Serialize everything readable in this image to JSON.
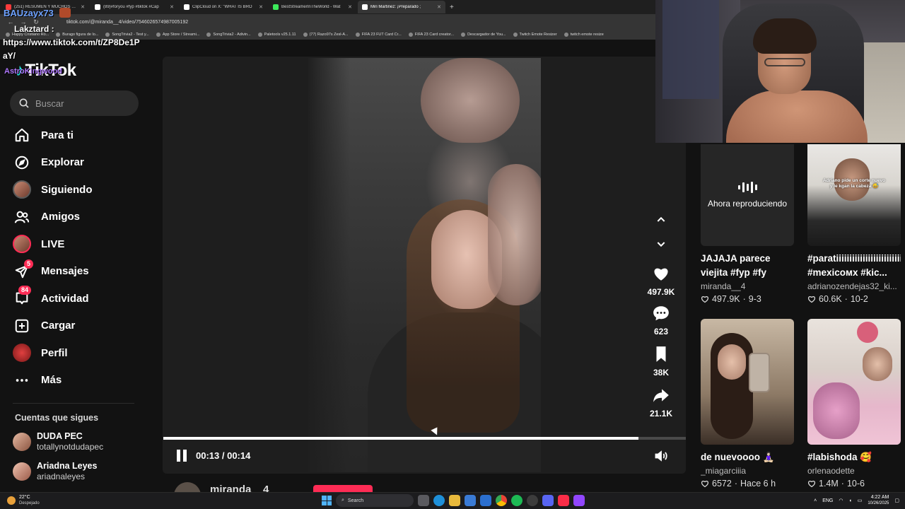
{
  "browser": {
    "tabs": [
      {
        "label": "(251) RESUMEN Y MUCHOS GO",
        "color": "#ff3b3b",
        "active": false
      },
      {
        "label": "(89)#foryou #fyp #tiktok #Cap",
        "color": "#ffffff",
        "active": false
      },
      {
        "label": "ClipCloud on X: \"WHAT IS BRO",
        "color": "#ffffff",
        "active": false
      },
      {
        "label": "BestStreamerInTheWorld - Wat",
        "color": "#3ce85a",
        "active": false
      },
      {
        "label": "Miri Martinez: ¡Preparado ;",
        "color": "#ffffff",
        "active": true
      }
    ],
    "url": "tiktok.com/@miranda__4/video/7546026574987005192",
    "bookmarks": [
      "Happy Cristiano Ro...",
      "Burago figura de lo...",
      "SongTrivia2 - Test y...",
      "App Store / Streami...",
      "SongTrivia2 - Adivin...",
      "Paletools v25.1.11",
      "(77) Razo97s Zesl-A...",
      "FIFA 23 FUT Card Cr...",
      "FIFA 23 Card creator...",
      "Descargador de You...",
      "Twitch Emote Resizer",
      "twitch emote resize"
    ]
  },
  "overlay": {
    "username": "BAUzayx73",
    "chat_name": "Lakztard :",
    "chat_link": "https://www.tiktok.com/t/ZP8De1P",
    "chat_cont": "aY/",
    "astro": "AstroKingwood"
  },
  "sidebar": {
    "logo": "TikTok",
    "search_placeholder": "Buscar",
    "items": [
      {
        "label": "Para ti",
        "icon": "home-icon"
      },
      {
        "label": "Explorar",
        "icon": "compass-icon"
      },
      {
        "label": "Siguiendo",
        "icon": "following-avatar-icon"
      },
      {
        "label": "Amigos",
        "icon": "friends-icon"
      },
      {
        "label": "LIVE",
        "icon": "live-avatar-icon"
      },
      {
        "label": "Mensajes",
        "icon": "messages-icon",
        "badge": "5"
      },
      {
        "label": "Actividad",
        "icon": "activity-icon",
        "badge": "84"
      },
      {
        "label": "Cargar",
        "icon": "upload-icon"
      },
      {
        "label": "Perfil",
        "icon": "profile-avatar-icon"
      },
      {
        "label": "Más",
        "icon": "more-icon"
      }
    ],
    "following_title": "Cuentas que sigues",
    "following": [
      {
        "name": "DUDA PEC",
        "handle": "totallynotdudapec"
      },
      {
        "name": "Ariadna Leyes",
        "handle": "ariadnaleyes"
      }
    ]
  },
  "player": {
    "progress": 0.91,
    "time": "00:13 / 00:14",
    "likes": "497.9K",
    "comments": "623",
    "saves": "38K",
    "shares": "21.1K",
    "author": "miranda__4"
  },
  "grid": [
    {
      "caption": "JAJAJA parece viejita #fyp #fy",
      "author": "miranda__4",
      "likes": "497.9K",
      "date": "9-3",
      "now_playing": "Ahora reproduciendo"
    },
    {
      "caption": "#paratiiiiiiiiiiiiiiiiiiiiiiiiiiiii #mexicoмх #kic...",
      "author": "adrianozendejas32_ki...",
      "likes": "60.6K",
      "date": "10-2",
      "thumb_text": "Adriano pide un corte nuevo y le kgan la cabeza 😅"
    },
    {
      "caption": "de nuevoooo 🧘🏻‍♀️",
      "author": "_miagarciiia",
      "likes": "6572",
      "date": "Hace 6 h"
    },
    {
      "caption": "#labishoda 🥰",
      "author": "orlenaodette",
      "likes": "1.4M",
      "date": "10-6"
    }
  ],
  "taskbar": {
    "temp": "22°C",
    "weather": "Despejado",
    "search": "Search",
    "lang": "ENG",
    "time": "4:22 AM",
    "date": "10/26/2025"
  }
}
